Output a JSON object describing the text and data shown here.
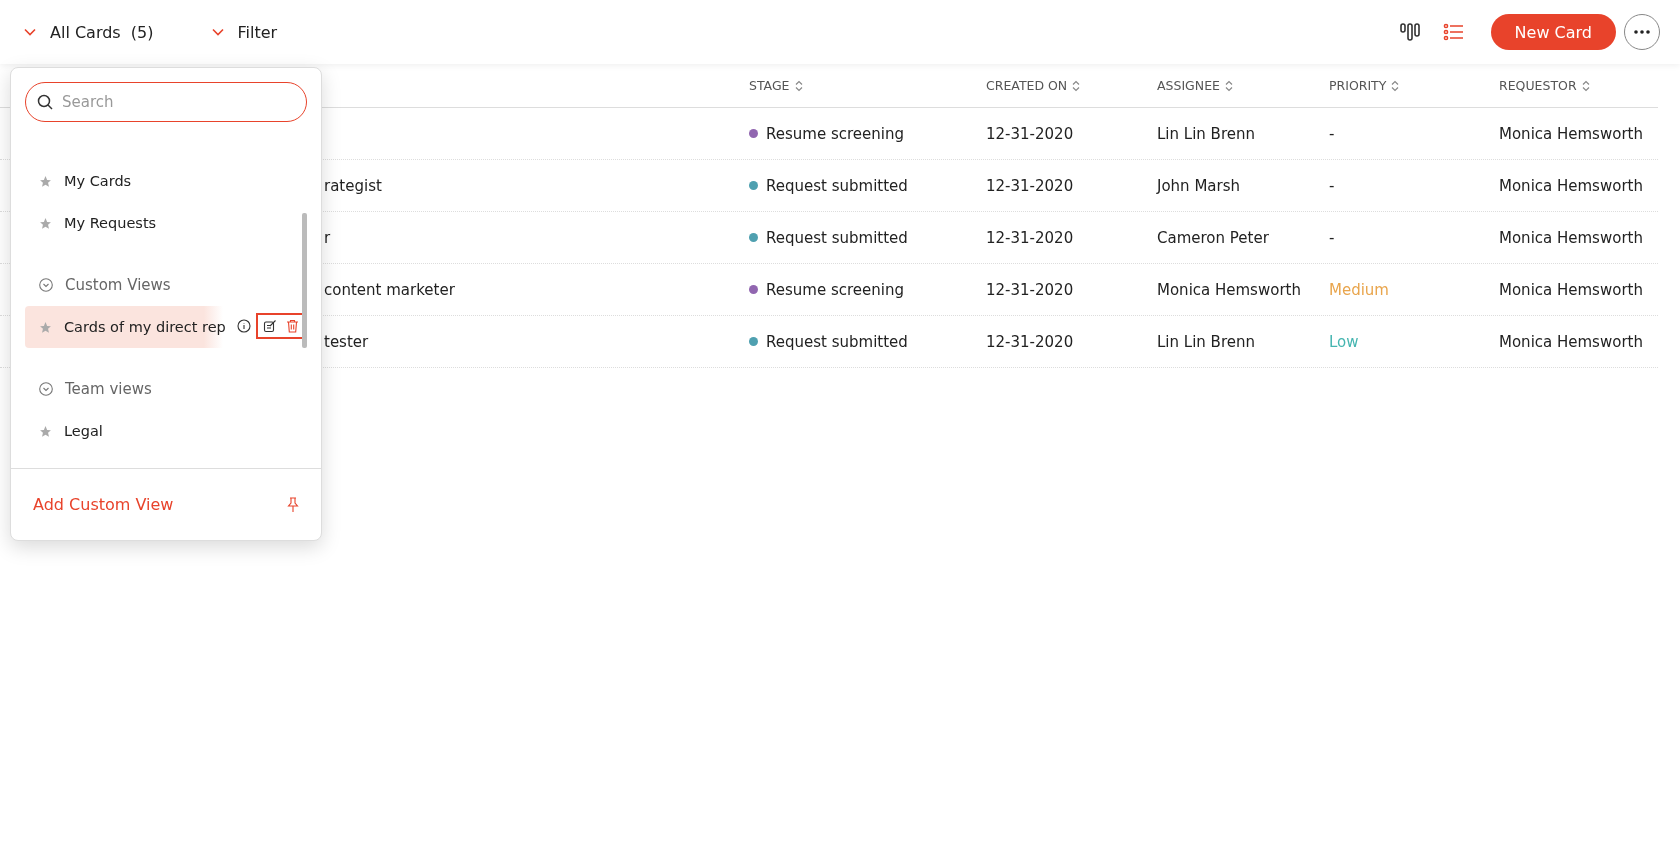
{
  "toolbar": {
    "view_label": "All Cards",
    "count": "(5)",
    "filter_label": "Filter",
    "new_button": "New Card",
    "layouts": [
      {
        "kind": "board",
        "selected": false
      },
      {
        "kind": "list",
        "selected": true
      }
    ]
  },
  "table": {
    "columns": [
      "STAGE",
      "CREATED ON",
      "ASSIGNEE",
      "PRIORITY",
      "REQUESTOR"
    ],
    "rows": [
      {
        "stage": {
          "label": "Resume screening",
          "color": "#9166b0"
        },
        "created": "12-31-2020",
        "assignee": "Lin Lin Brenn",
        "priority": {
          "label": "-"
        },
        "requestor": "Monica Hemsworth"
      },
      {
        "title": "rategist",
        "stage": {
          "label": "Request submitted",
          "color": "#4fa0b0"
        },
        "created": "12-31-2020",
        "assignee": "John Marsh",
        "priority": {
          "label": "-"
        },
        "requestor": "Monica Hemsworth"
      },
      {
        "title": "r",
        "stage": {
          "label": "Request submitted",
          "color": "#4fa0b0"
        },
        "created": "12-31-2020",
        "assignee": "Cameron Peter",
        "priority": {
          "label": "-"
        },
        "requestor": "Monica Hemsworth"
      },
      {
        "title": "content marketer",
        "stage": {
          "label": "Resume screening",
          "color": "#9166b0"
        },
        "created": "12-31-2020",
        "assignee": "Monica Hemsworth",
        "priority": {
          "label": "Medium",
          "color": "#e9a54c"
        },
        "requestor": "Monica Hemsworth"
      },
      {
        "title": "tester",
        "stage": {
          "label": "Request submitted",
          "color": "#4fa0b0"
        },
        "created": "12-31-2020",
        "assignee": "Lin Lin Brenn",
        "priority": {
          "label": "Low",
          "color": "#45b5b0"
        },
        "requestor": "Monica Hemsworth"
      }
    ]
  },
  "dropdown": {
    "search": {
      "placeholder": "Search"
    },
    "items": [
      {
        "kind": "view",
        "label": "My Cards",
        "selected": false
      },
      {
        "kind": "view",
        "label": "My Requests",
        "selected": false
      },
      {
        "kind": "section",
        "label": "Custom Views",
        "expanded": true
      },
      {
        "kind": "view",
        "label": "Cards of my direct rep",
        "selected": true
      },
      {
        "kind": "section",
        "label": "Team views",
        "expanded": true
      },
      {
        "kind": "view",
        "label": "Legal",
        "selected": false
      }
    ],
    "add_label": "Add Custom View"
  }
}
